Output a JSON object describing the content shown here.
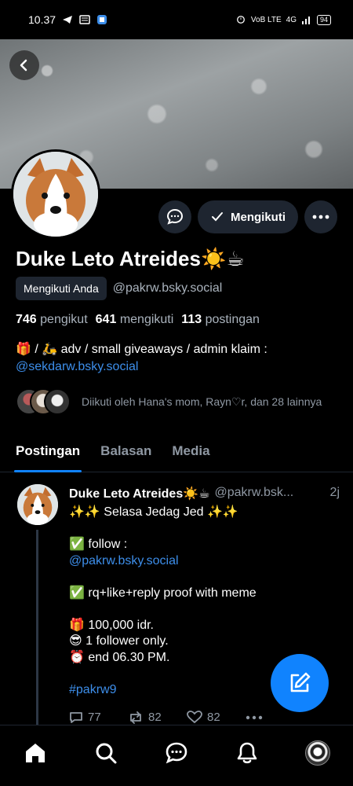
{
  "status_bar": {
    "time": "10.37",
    "network": "4G",
    "lte_label": "VoB LTE",
    "battery": "94",
    "icons": [
      "telegram-icon",
      "news-icon",
      "app-icon",
      "alarm-icon",
      "signal-icon",
      "battery-icon"
    ]
  },
  "header": {
    "back_icon": "back-arrow-icon"
  },
  "profile": {
    "name": "Duke Leto Atreides☀️☕",
    "follows_you_badge": "Mengikuti Anda",
    "handle": "@pakrw.bsky.social",
    "stats": {
      "followers_count": "746",
      "followers_label": "pengikut",
      "following_count": "641",
      "following_label": "mengikuti",
      "posts_count": "113",
      "posts_label": "postingan"
    },
    "bio_line1": "🎁 / 🛵 adv / small giveaways / admin klaim :",
    "bio_link": "@sekdarw.bsky.social",
    "followed_by": "Diikuti oleh Hana's mom, Rayn♡r, dan 28 lainnya",
    "actions": {
      "message_icon": "chat-bubble-icon",
      "follow_label": "Mengikuti",
      "follow_icon": "checkmark-icon",
      "more_icon": "ellipsis-icon"
    }
  },
  "tabs": [
    {
      "label": "Postingan",
      "active": true
    },
    {
      "label": "Balasan",
      "active": false
    },
    {
      "label": "Media",
      "active": false
    }
  ],
  "post": {
    "author": "Duke Leto Atreides☀️☕",
    "handle": "@pakrw.bsk...",
    "time": "2j",
    "line1": "✨✨ Selasa Jedag Jed ✨✨",
    "line2": "✅ follow :",
    "line3": "@pakrw.bsky.social",
    "line4": "✅ rq+like+reply proof with meme",
    "line5": "🎁 100,000 idr.",
    "line6": "😎 1 follower only.",
    "line7": "⏰  end 06.30 PM.",
    "hashtag": "#pakrw9",
    "replies": "77",
    "reposts": "82",
    "likes": "82"
  },
  "colors": {
    "accent": "#1083fe",
    "link": "#3d8eea",
    "muted": "#8f98a3",
    "surface": "#1e2530"
  },
  "nav": [
    "home-icon",
    "search-icon",
    "chat-icon",
    "bell-icon",
    "profile-avatar"
  ]
}
